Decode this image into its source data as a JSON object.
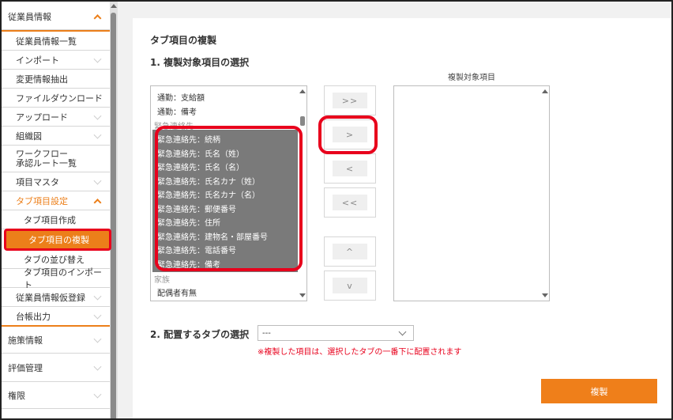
{
  "sidebar": {
    "employee_info": "従業員情報",
    "items": {
      "employee_list": "従業員情報一覧",
      "import": "インポート",
      "change_extract": "変更情報抽出",
      "file_download": "ファイルダウンロード",
      "upload": "アップロード",
      "org_chart": "組織図",
      "workflow_1": "ワークフロー",
      "workflow_2": "承認ルート一覧",
      "item_master": "項目マスタ",
      "tab_item_settings": "タブ項目設定",
      "tab_item_create": "タブ項目作成",
      "tab_item_copy": "タブ項目の複製",
      "tab_reorder": "タブの並び替え",
      "tab_item_import": "タブ項目のインポート",
      "employee_temp": "従業員情報仮登録",
      "ledger_output": "台帳出力"
    },
    "measures": "施策情報",
    "evaluation": "評価管理",
    "permissions": "権限"
  },
  "main": {
    "title": "タブ項目の複製",
    "section1": "1. 複製対象項目の選択",
    "target_header": "複製対象項目",
    "source_list": {
      "top_items": [
        "通勤：支給額",
        "通勤：備考"
      ],
      "group_emergency": "緊急連絡先",
      "selected_items": [
        "緊急連絡先：続柄",
        "緊急連絡先：氏名（姓）",
        "緊急連絡先：氏名（名）",
        "緊急連絡先：氏名カナ（姓）",
        "緊急連絡先：氏名カナ（名）",
        "緊急連絡先：郵便番号",
        "緊急連絡先：住所",
        "緊急連絡先：建物名・部屋番号",
        "緊急連絡先：電話番号",
        "緊急連絡先：備考"
      ],
      "group_family": "家族",
      "bottom_items": [
        "配偶者有無"
      ]
    },
    "buttons": {
      "add_all": ">>",
      "add": ">",
      "remove": "<",
      "remove_all": "<<",
      "up": "^",
      "down": "v"
    },
    "section2": "2. 配置するタブの選択",
    "tab_select_value": "---",
    "note": "※複製した項目は、選択したタブの一番下に配置されます",
    "copy_button": "複製"
  },
  "colors": {
    "accent": "#ec7f1a",
    "highlight": "#e8001c",
    "selection": "#7a7a7a"
  }
}
